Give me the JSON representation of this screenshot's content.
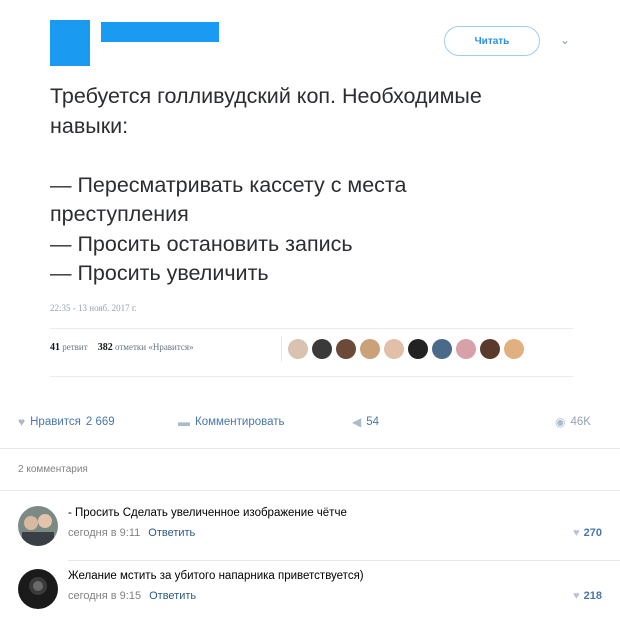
{
  "tweet": {
    "follow_label": "Читать",
    "chevron": "⌄",
    "text": "Требуется голливудский коп. Необходимые\nнавыки:\n\n— Пересматривать кассету с места\nпреступления\n— Просить остановить запись\n— Просить увеличить",
    "timestamp": "22:35 - 13 нояб. 2017 г.",
    "retweets_count": "41",
    "retweets_label": "ретвит",
    "likes_count": "382",
    "likes_label": "отметки «Нравится»",
    "liker_colors": [
      "#d9c2b0",
      "#3a3a3a",
      "#6b4a3a",
      "#c9a27a",
      "#e2bfa8",
      "#222222",
      "#4a6a8a",
      "#d8a0a8",
      "#5a3a2a",
      "#e0b080"
    ]
  },
  "actions": {
    "like_label": "Нравится",
    "like_count": "2 669",
    "comment_label": "Комментировать",
    "share_count": "54",
    "views_count": "46K"
  },
  "comments": {
    "count_label": "2 комментария",
    "items": [
      {
        "text": "- Просить Сделать увеличенное изображение чётче",
        "time": "сегодня в 9:11",
        "reply": "Ответить",
        "likes": "270"
      },
      {
        "text": "Желание мстить за убитого напарника приветствуется)",
        "time": "сегодня в 9:15",
        "reply": "Ответить",
        "likes": "218"
      }
    ]
  },
  "colors": {
    "redaction": "#1a9af0",
    "link": "#2a5885"
  }
}
